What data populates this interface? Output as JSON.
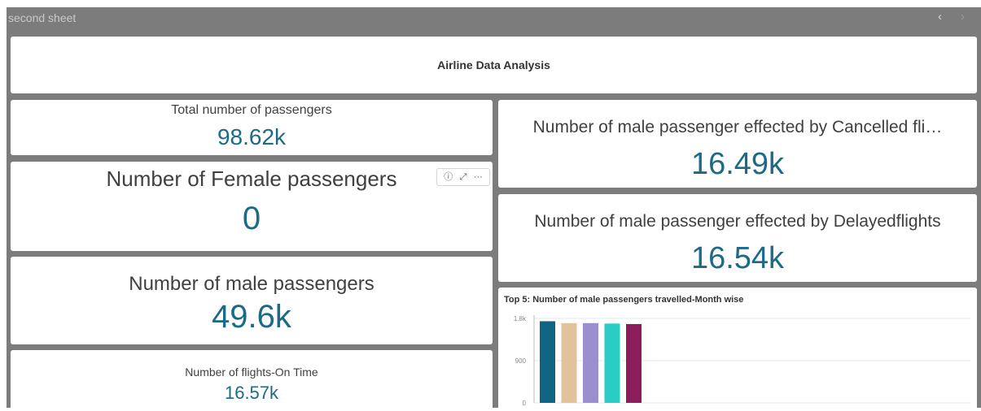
{
  "sheet": {
    "title": "second sheet",
    "nav_prev": "‹",
    "nav_next": "›"
  },
  "header": {
    "title": "Airline Data Analysis"
  },
  "kpis": {
    "total_passengers": {
      "label": "Total number of passengers",
      "value": "98.62k"
    },
    "female_passengers": {
      "label": "Number of Female passengers",
      "value": "0"
    },
    "male_passengers": {
      "label": "Number of male passengers",
      "value": "49.6k"
    },
    "flights_on_time": {
      "label": "Number of flights-On Time",
      "value": "16.57k"
    },
    "male_cancelled": {
      "label": "Number of male passenger effected by Cancelled fli…",
      "value": "16.49k"
    },
    "male_delayed": {
      "label": "Number of male passenger effected by Delayedflights",
      "value": "16.54k"
    }
  },
  "toolbar": {
    "info_icon": "ⓘ",
    "expand_icon": "⤢",
    "more_icon": "···"
  },
  "colors": {
    "accent": "#1d6a86",
    "sheet_background": "#7c7c7c"
  },
  "chart_data": {
    "type": "bar",
    "title": "Top 5: Number of male passengers travelled-Month wise",
    "categories": [],
    "values": [
      1740,
      1700,
      1700,
      1690,
      1680
    ],
    "bar_colors": [
      "#0f6482",
      "#e0c39a",
      "#9c8fcf",
      "#29cdc4",
      "#8b1e5a"
    ],
    "ylim": [
      0,
      1800
    ],
    "y_ticks": [
      0,
      900,
      1800
    ],
    "y_tick_labels": [
      "0",
      "900",
      "1.8k"
    ],
    "grid": true
  }
}
